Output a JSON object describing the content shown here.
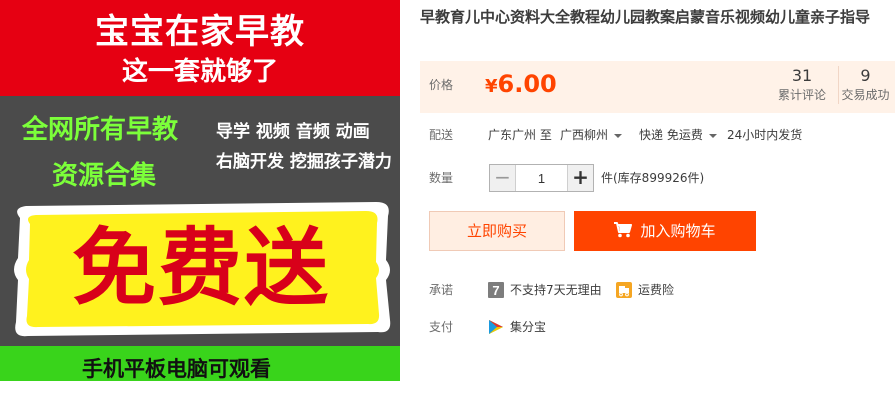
{
  "image": {
    "banner_line1": "宝宝在家早教",
    "banner_line2": "这一套就够了",
    "green_line1": "全网所有早教",
    "green_line2": "资源合集",
    "white_line1": "导学 视频 音频 动画",
    "white_line2": "右脑开发 挖掘孩子潜力",
    "free_text": "免费送",
    "bottom_text": "手机平板电脑可观看"
  },
  "product": {
    "title": "早教育儿中心资料大全教程幼儿园教案启蒙音乐视频幼儿童亲子指导"
  },
  "price": {
    "label": "价格",
    "currency": "¥",
    "value": "6.00",
    "comments_count": "31",
    "comments_label": "累计评论",
    "deals_count": "9",
    "deals_label": "交易成功"
  },
  "shipping": {
    "label": "配送",
    "from": "广东广州 至",
    "to": "广西柳州",
    "method": "快递 免运费",
    "dispatch": "24小时内发货"
  },
  "quantity": {
    "label": "数量",
    "value": "1",
    "minus": "−",
    "plus": "+",
    "stock": "件(库存899926件)"
  },
  "actions": {
    "buy_now": "立即购买",
    "add_to_cart": "加入购物车"
  },
  "promise": {
    "label": "承诺",
    "no_return": "不支持7天无理由",
    "freight_insurance": "运费险"
  },
  "payment": {
    "label": "支付",
    "method": "集分宝"
  },
  "colors": {
    "accent": "#ff4400",
    "price": "#ff4400",
    "banner_red": "#e60012",
    "banner_green": "#39d41b"
  },
  "icons": {
    "cart": "cart-icon",
    "seven_day": "seven-day-icon",
    "freight": "freight-insurance-icon",
    "jifenbao": "jifenbao-icon"
  }
}
